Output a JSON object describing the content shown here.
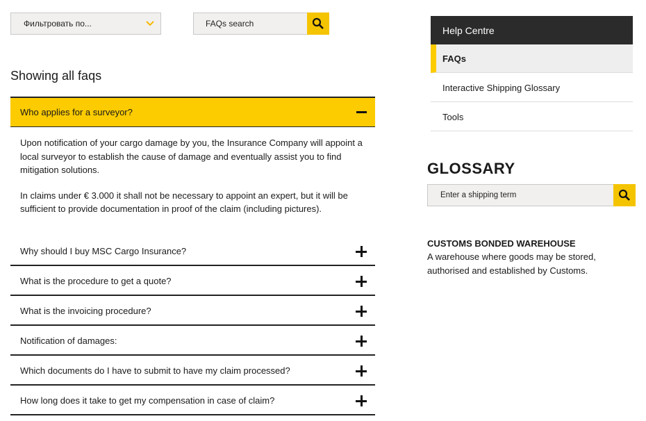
{
  "filter": {
    "label": "Фильтровать по...",
    "icon": "chevron-down-icon"
  },
  "faq_search": {
    "placeholder": "FAQs search",
    "icon": "search-icon"
  },
  "main": {
    "heading": "Showing all faqs",
    "open_faq": {
      "question": "Who applies for a surveyor?",
      "answer_p1": "Upon notification of your cargo damage by you, the Insurance Company will appoint a local surveyor to establish the cause of damage and eventually assist you to find mitigation solutions.",
      "answer_p2": "In claims under € 3.000 it shall not be necessary to appoint an expert, but it will be sufficient to provide documentation in proof of the claim (including pictures)."
    },
    "faqs": [
      "Why should I buy MSC Cargo Insurance?",
      "What is the procedure to get a quote?",
      "What is the invoicing procedure?",
      "Notification of damages:",
      "Which documents do I have to submit to have my claim processed?",
      "How long does it take to get my compensation in case of claim?"
    ]
  },
  "sidebar": {
    "title": "Help Centre",
    "items": [
      "FAQs",
      "Interactive Shipping Glossary",
      "Tools"
    ],
    "active_index": 0
  },
  "glossary": {
    "title": "GLOSSARY",
    "search_placeholder": "Enter a shipping term",
    "term": "CUSTOMS BONDED WAREHOUSE",
    "definition": "A warehouse where goods may be stored, authorised and established by Customs."
  },
  "colors": {
    "accent": "#fccb00",
    "dark": "#2b2b2b"
  }
}
